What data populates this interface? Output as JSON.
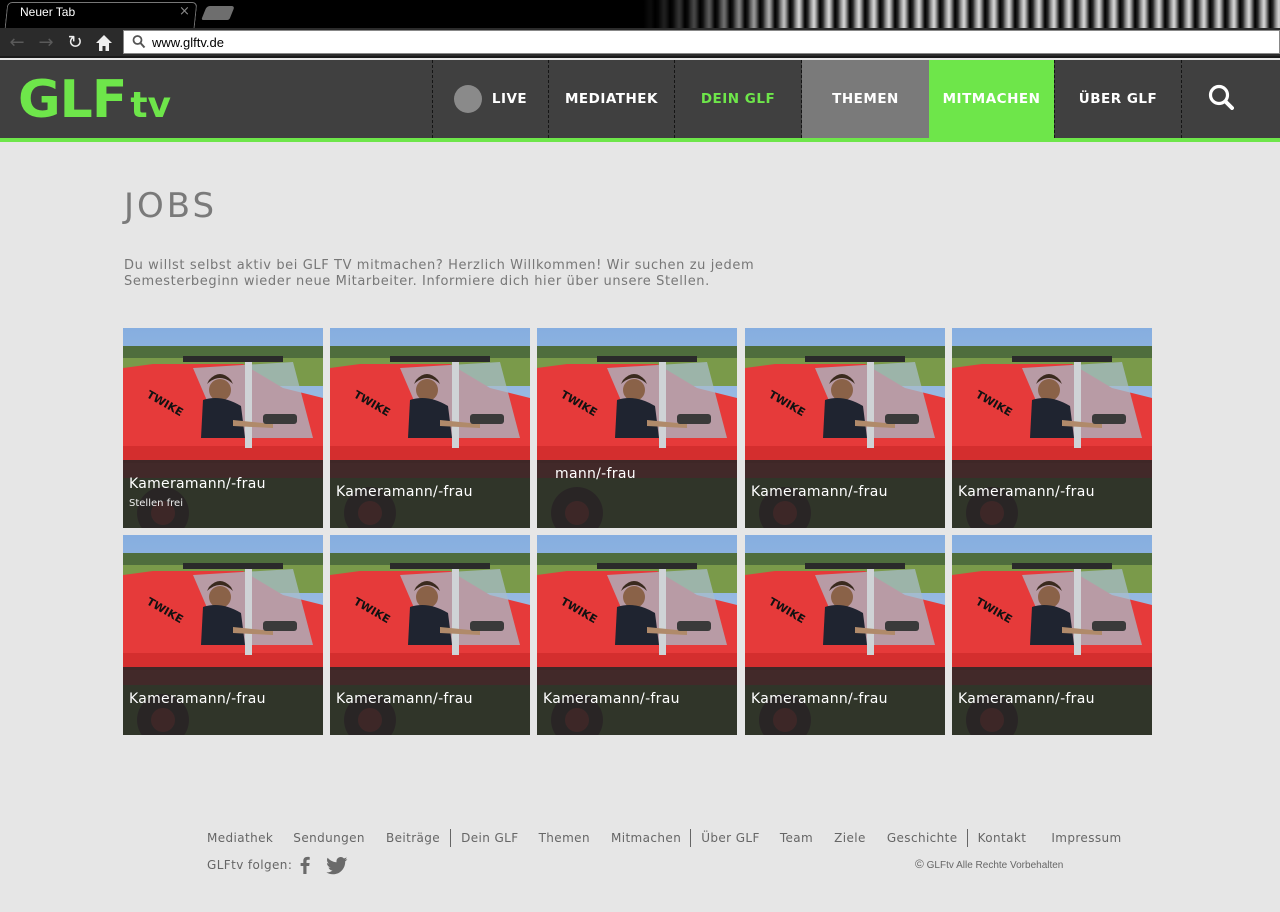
{
  "browser": {
    "tab_title": "Neuer Tab",
    "tab_close": "×",
    "url": "www.glftv.de"
  },
  "site": {
    "logo_main": "GLF",
    "logo_sub": "tv",
    "accent_color": "#6ee64a",
    "nav": [
      {
        "label": "LIVE"
      },
      {
        "label": "MEDIATHEK"
      },
      {
        "label": "DEIN GLF"
      },
      {
        "label": "THEMEN"
      },
      {
        "label": "MITMACHEN"
      },
      {
        "label": "ÜBER GLF"
      }
    ],
    "search_icon": "search-icon"
  },
  "main": {
    "title": "JOBS",
    "intro": "Du willst selbst aktiv bei GLF TV mitmachen? Herzlich Willkommen! Wir suchen zu jedem Semesterbeginn wieder neue Mitarbeiter. Informiere dich hier über unsere Stellen.",
    "jobs": [
      {
        "title": "Kameramann/-frau",
        "subtitle": "Stellen frei"
      },
      {
        "title": "Kameramann/-frau"
      },
      {
        "title": "mann/-frau"
      },
      {
        "title": "Kameramann/-frau"
      },
      {
        "title": "Kameramann/-frau"
      },
      {
        "title": "Kameramann/-frau"
      },
      {
        "title": "Kameramann/-frau"
      },
      {
        "title": "Kameramann/-frau"
      },
      {
        "title": "Kameramann/-frau"
      },
      {
        "title": "Kameramann/-frau"
      }
    ]
  },
  "footer": {
    "links": [
      "Mediathek",
      "Sendungen",
      "Beiträge",
      "Dein GLF",
      "Themen",
      "Mitmachen",
      "Über GLF",
      "Team",
      "Ziele",
      "Geschichte",
      "Kontakt",
      "Impressum"
    ],
    "follow": "GLFtv folgen:",
    "copyright_symbol": "©",
    "copyright": "GLFtv Alle Rechte Vorbehalten"
  }
}
